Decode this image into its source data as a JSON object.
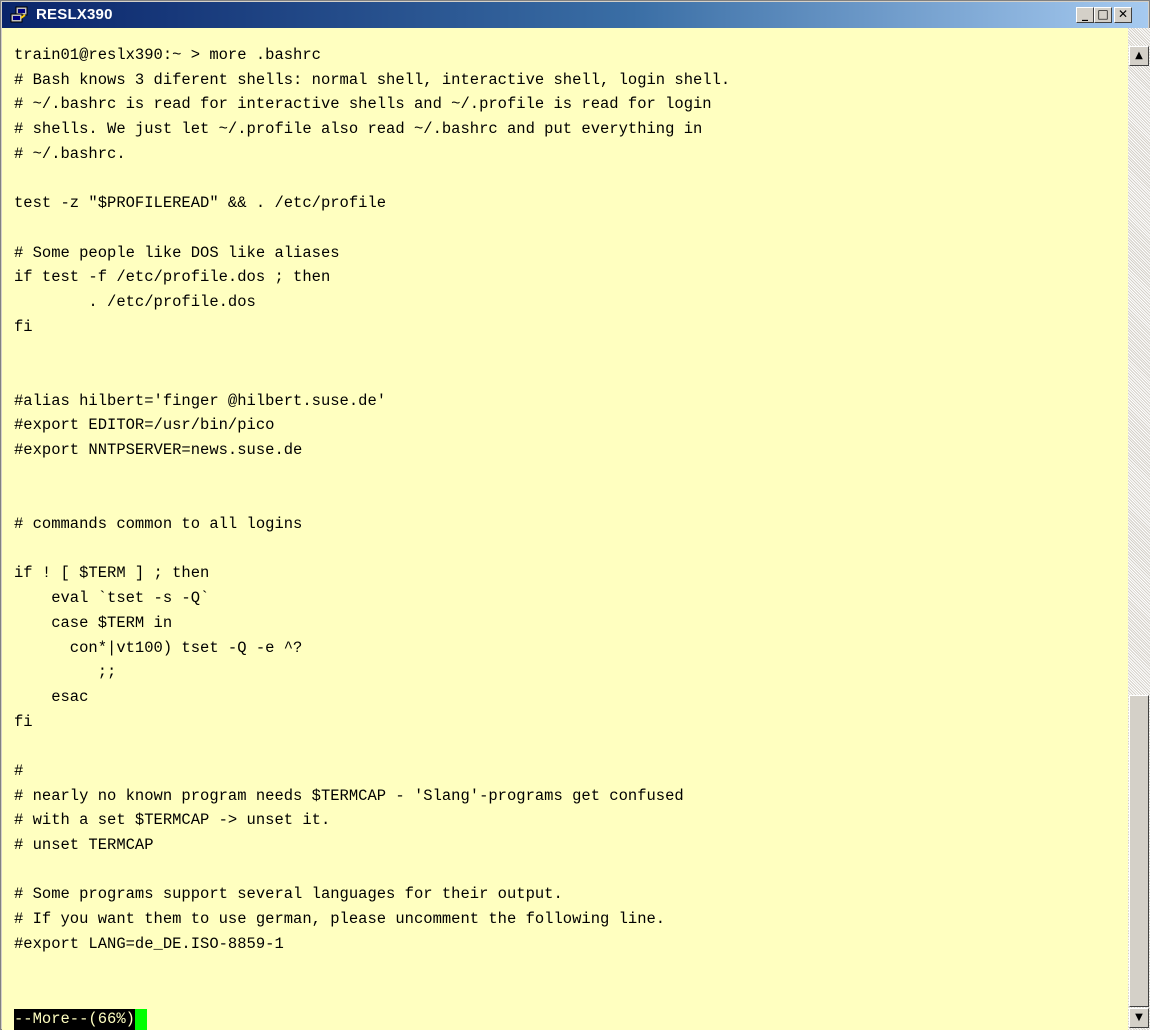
{
  "window": {
    "title": "RESLX390",
    "icon": "putty-icon",
    "controls": {
      "minimize": "_",
      "maximize": "□",
      "close": "✕"
    }
  },
  "terminal": {
    "lines": [
      "train01@reslx390:~ > more .bashrc",
      "# Bash knows 3 diferent shells: normal shell, interactive shell, login shell.",
      "# ~/.bashrc is read for interactive shells and ~/.profile is read for login",
      "# shells. We just let ~/.profile also read ~/.bashrc and put everything in",
      "# ~/.bashrc.",
      "",
      "test -z \"$PROFILEREAD\" && . /etc/profile",
      "",
      "# Some people like DOS like aliases",
      "if test -f /etc/profile.dos ; then",
      "        . /etc/profile.dos",
      "fi",
      "",
      "",
      "#alias hilbert='finger @hilbert.suse.de'",
      "#export EDITOR=/usr/bin/pico",
      "#export NNTPSERVER=news.suse.de",
      "",
      "",
      "# commands common to all logins",
      "",
      "if ! [ $TERM ] ; then",
      "    eval `tset -s -Q`",
      "    case $TERM in",
      "      con*|vt100) tset -Q -e ^?",
      "         ;;",
      "    esac",
      "fi",
      "",
      "#",
      "# nearly no known program needs $TERMCAP - 'Slang'-programs get confused",
      "# with a set $TERMCAP -> unset it.",
      "# unset TERMCAP",
      "",
      "# Some programs support several languages for their output.",
      "# If you want them to use german, please uncomment the following line.",
      "#export LANG=de_DE.ISO-8859-1"
    ],
    "pager_status": "--More--(66%)"
  },
  "scrollbar": {
    "up_arrow": "▲",
    "down_arrow": "▼",
    "position_fraction": 0.66
  },
  "colors": {
    "terminal_background": "#ffffc0",
    "terminal_text": "#000000",
    "cursor": "#00ff00",
    "title_bar_start": "#0a246a",
    "title_bar_end": "#a6caf0"
  }
}
